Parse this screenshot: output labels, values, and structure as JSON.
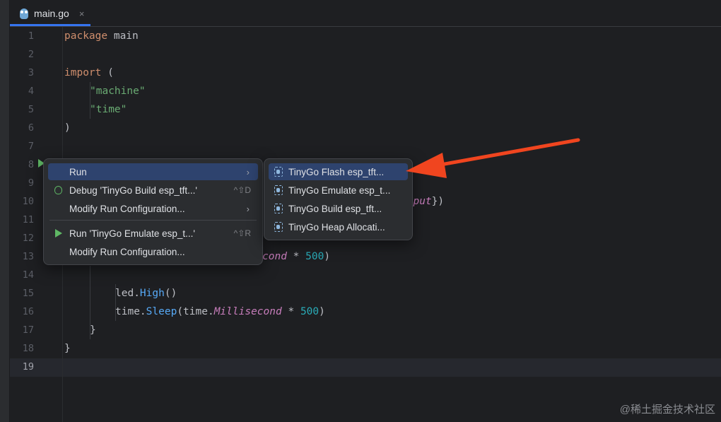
{
  "tab": {
    "filename": "main.go",
    "close": "×",
    "icon": "gopher-icon"
  },
  "lines": [
    {
      "n": "1"
    },
    {
      "n": "2"
    },
    {
      "n": "3"
    },
    {
      "n": "4"
    },
    {
      "n": "5"
    },
    {
      "n": "6"
    },
    {
      "n": "7"
    },
    {
      "n": "8"
    },
    {
      "n": "9"
    },
    {
      "n": "10"
    },
    {
      "n": "11"
    },
    {
      "n": "12"
    },
    {
      "n": "13"
    },
    {
      "n": "14"
    },
    {
      "n": "15"
    },
    {
      "n": "16"
    },
    {
      "n": "17"
    },
    {
      "n": "18"
    },
    {
      "n": "19"
    }
  ],
  "code": {
    "l1_kw": "package",
    "l1_rest": " main",
    "l3_kw": "import",
    "l3_rest": " (",
    "l4": "\"machine\"",
    "l5": "\"time\"",
    "l6": ")",
    "l10_a": "utput",
    "l10_b": "})",
    "l13_a": "cond",
    "l13_b": " * ",
    "l13_c": "500",
    "l13_d": ")",
    "l15_a": "led.",
    "l15_b": "High",
    "l15_c": "()",
    "l16_a": "time.",
    "l16_b": "Sleep",
    "l16_c": "(time.",
    "l16_d": "Millisecond",
    "l16_e": " * ",
    "l16_f": "500",
    "l16_g": ")",
    "l17": "}",
    "l18": "}"
  },
  "context_menu": {
    "items": [
      {
        "label": "Run",
        "arrow": "›"
      },
      {
        "label": "Debug 'TinyGo Build esp_tft...'",
        "shortcut": "^⇧D",
        "icon": "bug-icon"
      },
      {
        "label": "Modify Run Configuration...",
        "arrow": "›"
      },
      {
        "label": "Run 'TinyGo Emulate esp_t...'",
        "shortcut": "^⇧R",
        "icon": "play-icon"
      },
      {
        "label": "Modify Run Configuration..."
      }
    ]
  },
  "submenu": {
    "items": [
      {
        "label": "TinyGo Flash esp_tft..."
      },
      {
        "label": "TinyGo Emulate esp_t..."
      },
      {
        "label": "TinyGo Build esp_tft..."
      },
      {
        "label": "TinyGo Heap Allocati..."
      }
    ]
  },
  "watermark": "@稀土掘金技术社区",
  "colors": {
    "accent": "#3574f0",
    "selection": "#2e436e",
    "arrow": "#f0451f",
    "run_green": "#5fb865"
  }
}
